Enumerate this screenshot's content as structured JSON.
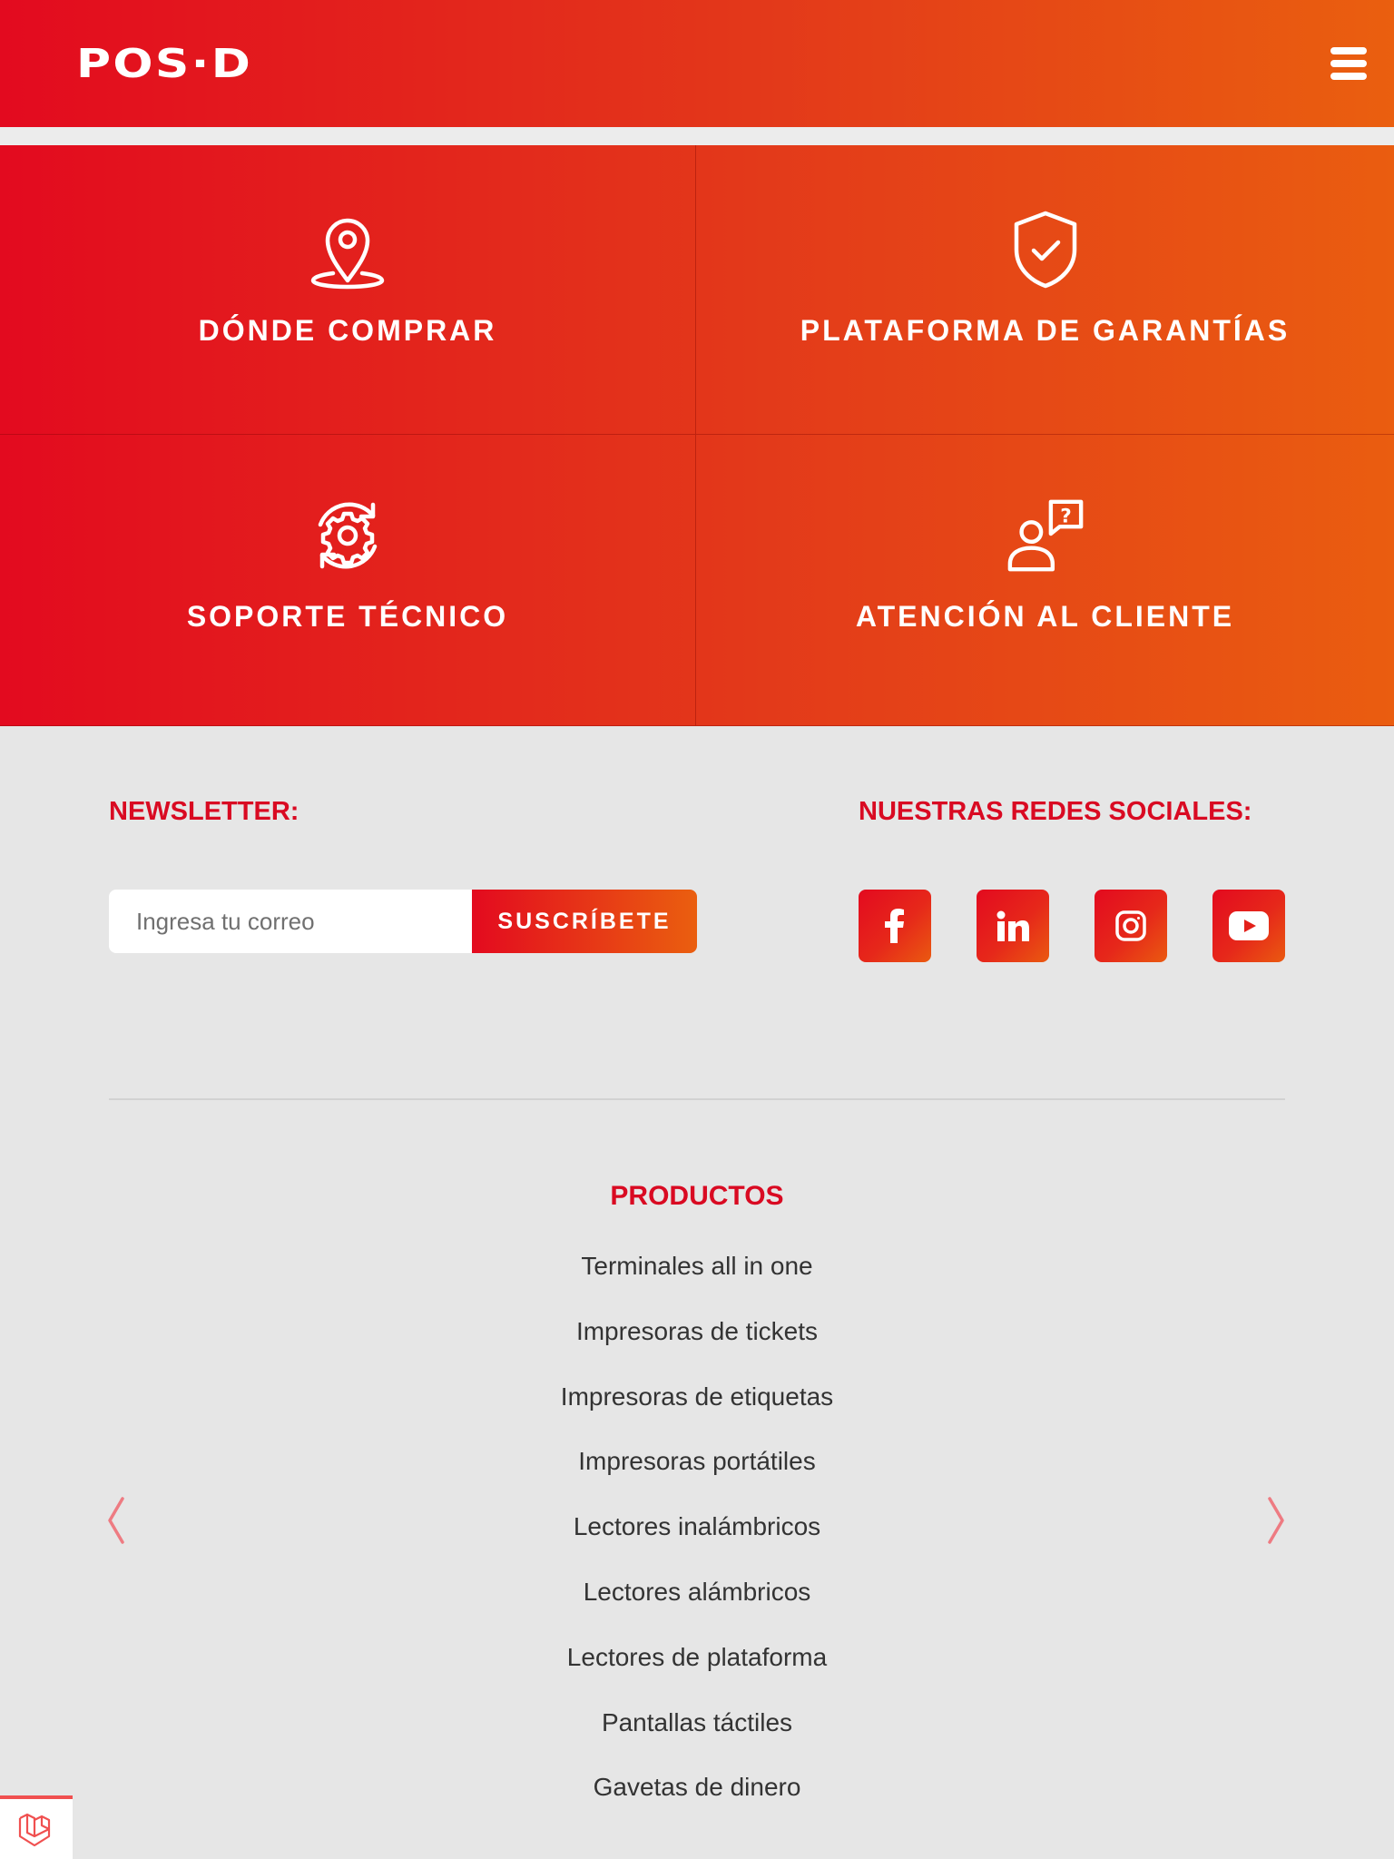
{
  "header": {
    "logo_text": "POS·D",
    "menu_icon": "hamburger-icon"
  },
  "tiles": [
    {
      "label": "DÓNDE COMPRAR",
      "icon": "location-pin-icon"
    },
    {
      "label": "PLATAFORMA DE GARANTÍAS",
      "icon": "shield-check-icon"
    },
    {
      "label": "SOPORTE TÉCNICO",
      "icon": "gear-refresh-icon"
    },
    {
      "label": "ATENCIÓN AL CLIENTE",
      "icon": "user-question-icon"
    }
  ],
  "newsletter": {
    "title": "NEWSLETTER:",
    "placeholder": "Ingresa tu correo",
    "value": "",
    "button_label": "SUSCRÍBETE"
  },
  "social": {
    "title": "NUESTRAS REDES SOCIALES:",
    "links": [
      {
        "name": "facebook",
        "icon": "facebook-icon"
      },
      {
        "name": "linkedin",
        "icon": "linkedin-icon"
      },
      {
        "name": "instagram",
        "icon": "instagram-icon"
      },
      {
        "name": "youtube",
        "icon": "youtube-icon"
      }
    ]
  },
  "products": {
    "title": "PRODUCTOS",
    "items": [
      "Terminales all in one",
      "Impresoras de tickets",
      "Impresoras de etiquetas",
      "Impresoras portátiles",
      "Lectores inalámbricos",
      "Lectores alámbricos",
      "Lectores de plataforma",
      "Pantallas táctiles",
      "Gavetas de dinero"
    ]
  },
  "carousel": {
    "prev_icon": "chevron-left-icon",
    "next_icon": "chevron-right-icon"
  },
  "colors": {
    "brand_red": "#e30a1f",
    "brand_orange": "#ea5f0f",
    "title_red": "#d90a22",
    "background": "#e6e6e6"
  }
}
